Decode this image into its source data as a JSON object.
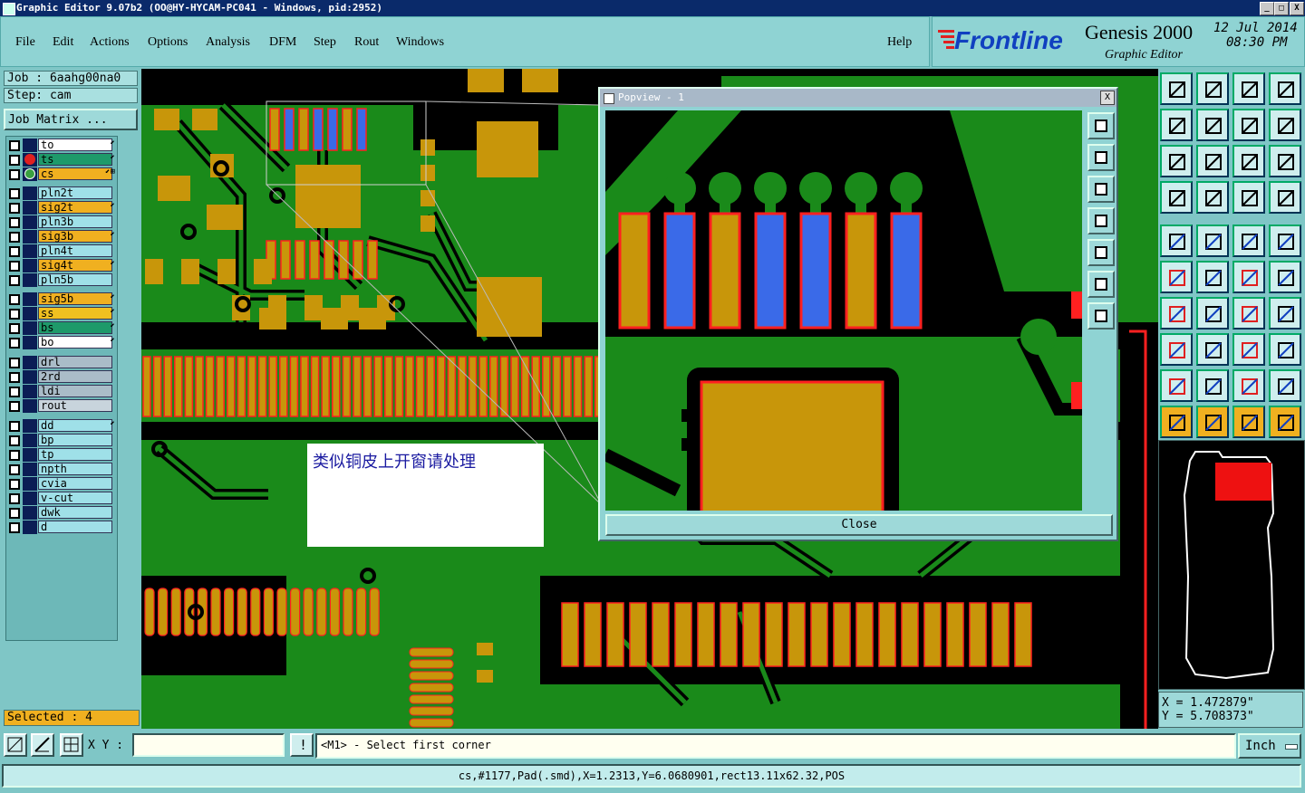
{
  "titlebar": {
    "text": "Graphic Editor 9.07b2 (OO@HY-HYCAM-PC041 - Windows, pid:2952)",
    "btn_min": "_",
    "btn_max": "□",
    "btn_close": "X"
  },
  "menu": [
    "File",
    "Edit",
    "Actions",
    "Options",
    "Analysis",
    "DFM",
    "Step",
    "Rout",
    "Windows"
  ],
  "help": "Help",
  "brand": {
    "logo": "Frontline",
    "product": "Genesis 2000",
    "sub": "Graphic Editor",
    "date": "12 Jul 2014",
    "time": "08:30 PM"
  },
  "job": {
    "job_line": "Job : 6aahg00na0",
    "step_line": "Step: cam",
    "matrix_button": "Job Matrix ..."
  },
  "layers": [
    {
      "name": "to",
      "color": "#ffffff",
      "mark": "⬋"
    },
    {
      "name": "ts",
      "color": "#1e9a6a",
      "mark": "⬋",
      "active": "red"
    },
    {
      "name": "cs",
      "color": "#f0b020",
      "mark": "⬋⊞",
      "active": "edit"
    },
    {
      "name": "pln2t",
      "color": "#9fe0e8",
      "mark": ""
    },
    {
      "name": "sig2t",
      "color": "#f0b020",
      "mark": "⬋"
    },
    {
      "name": "pln3b",
      "color": "#9fe0e8",
      "mark": ""
    },
    {
      "name": "sig3b",
      "color": "#f0b020",
      "mark": "⬋"
    },
    {
      "name": "pln4t",
      "color": "#9fe0e8",
      "mark": ""
    },
    {
      "name": "sig4t",
      "color": "#f0b020",
      "mark": "⬋"
    },
    {
      "name": "pln5b",
      "color": "#9fe0e8",
      "mark": ""
    },
    {
      "name": "sig5b",
      "color": "#f0b020",
      "mark": "⬋"
    },
    {
      "name": "ss",
      "color": "#f0c020",
      "mark": "⬋"
    },
    {
      "name": "bs",
      "color": "#1e9a6a",
      "mark": "⬋"
    },
    {
      "name": "bo",
      "color": "#ffffff",
      "mark": "⬋"
    },
    {
      "name": "drl",
      "color": "#aabcc8",
      "mark": ""
    },
    {
      "name": "2rd",
      "color": "#aabcc8",
      "mark": ""
    },
    {
      "name": "ldi",
      "color": "#aabcc8",
      "mark": ""
    },
    {
      "name": "rout",
      "color": "#c8d4dc",
      "mark": ""
    },
    {
      "name": "dd",
      "color": "#9fe0e8",
      "mark": "⬋"
    },
    {
      "name": "bp",
      "color": "#9fe0e8",
      "mark": ""
    },
    {
      "name": "tp",
      "color": "#9fe0e8",
      "mark": ""
    },
    {
      "name": "npth",
      "color": "#9fe0e8",
      "mark": ""
    },
    {
      "name": "cvia",
      "color": "#9fe0e8",
      "mark": ""
    },
    {
      "name": "v-cut",
      "color": "#9fe0e8",
      "mark": ""
    },
    {
      "name": "dwk",
      "color": "#9fe0e8",
      "mark": ""
    },
    {
      "name": "d",
      "color": "#9fe0e8",
      "mark": ""
    }
  ],
  "selected": "Selected : 4",
  "note": "类似铜皮上开窗请处理",
  "popview": {
    "title": "Popview - 1",
    "close": "Close",
    "close_x": "X"
  },
  "coords": {
    "x": "X = 1.472879\"",
    "y": "Y = 5.708373\""
  },
  "xy_label": "X Y :",
  "xy_value": "",
  "prompt": "<M1> - Select first corner",
  "units": "Inch",
  "status": "cs,#1177,Pad(.smd),X=1.2313,Y=6.0680901,rect13.11x62.32,POS",
  "colors": {
    "board": "#1a8a1a",
    "pad": "#c8960a",
    "pad_outline": "#ff2020",
    "highlight": "#3a6ae8",
    "title_bg": "#0a2a6a",
    "panel": "#7fc6c6"
  }
}
